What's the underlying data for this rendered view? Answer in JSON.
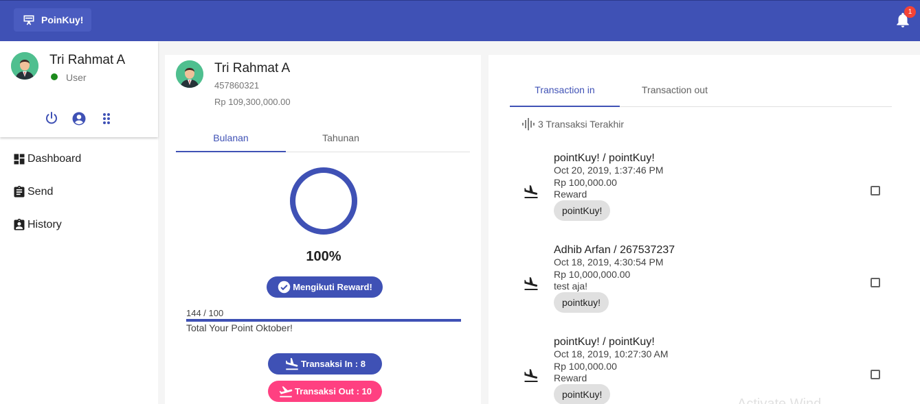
{
  "app": {
    "brand": "PoinKuy!",
    "notification_count": "1"
  },
  "sidebar": {
    "user_name": "Tri Rahmat A",
    "role": "User",
    "nav": [
      {
        "label": "Dashboard",
        "icon": "dashboard-icon"
      },
      {
        "label": "Send",
        "icon": "clipboard-icon"
      },
      {
        "label": "History",
        "icon": "badge-icon"
      }
    ]
  },
  "account": {
    "name": "Tri Rahmat A",
    "number": "457860321",
    "balance": "Rp 109,300,000.00",
    "tabs": [
      "Bulanan",
      "Tahunan"
    ],
    "active_tab": "Bulanan",
    "progress_percent": 100,
    "progress_label": "100%",
    "reward_button": "Mengikuti Reward!",
    "points": "144 / 100",
    "points_fraction": 1.0,
    "points_caption": "Total Your Point Oktober!",
    "trans_in_button": "Transaksi In : 8",
    "trans_out_button": "Transaksi Out : 10"
  },
  "transactions": {
    "tabs": [
      "Transaction in",
      "Transaction out"
    ],
    "active_tab": "Transaction in",
    "recent_label": "3 Transaksi Terakhir",
    "items": [
      {
        "title": "pointKuy! / pointKuy!",
        "date": "Oct 20, 2019, 1:37:46 PM",
        "amount": "Rp 100,000.00",
        "note": "Reward",
        "chip": "pointKuy!",
        "checked": false
      },
      {
        "title": "Adhib Arfan / 267537237",
        "date": "Oct 18, 2019, 4:30:54 PM",
        "amount": "Rp 10,000,000.00",
        "note": "test aja!",
        "chip": "pointkuy!",
        "checked": false
      },
      {
        "title": "pointKuy! / pointKuy!",
        "date": "Oct 18, 2019, 10:27:30 AM",
        "amount": "Rp 100,000.00",
        "note": "Reward",
        "chip": "pointKuy!",
        "checked": false
      }
    ]
  },
  "system": {
    "watermark": "Activate Wind"
  },
  "colors": {
    "primary": "#3f51b5",
    "accent": "#ff4081",
    "online": "#1b8a1b",
    "badge": "#f44336"
  }
}
